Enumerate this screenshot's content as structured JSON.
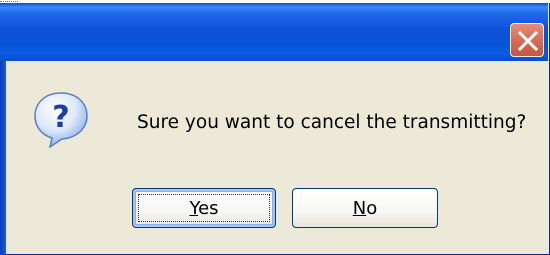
{
  "dialog": {
    "message": "Sure you want to cancel the transmitting?",
    "buttons": {
      "yes": {
        "mnemonic": "Y",
        "rest": "es"
      },
      "no": {
        "mnemonic": "N",
        "rest": "o"
      }
    },
    "icon": "question-icon",
    "close_icon": "close-icon"
  },
  "colors": {
    "title_bar": "#0853d6",
    "dialog_bg": "#ece9d8",
    "close_button": "#d6705a"
  }
}
